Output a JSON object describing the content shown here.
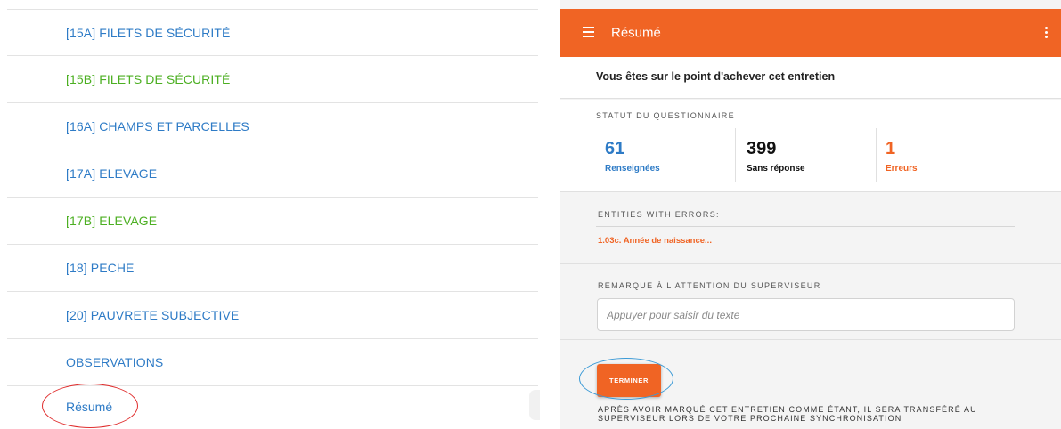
{
  "sections": {
    "items": [
      {
        "code": "[15A]",
        "name": "FILETS DE SÉCURITÉ",
        "color": "#2e7bc6"
      },
      {
        "code": "[15B]",
        "name": "FILETS DE SÉCURITÉ",
        "color": "#4caf22"
      },
      {
        "code": "[16A]",
        "name": "CHAMPS ET PARCELLES",
        "color": "#2e7bc6"
      },
      {
        "code": "[17A]",
        "name": "ELEVAGE",
        "color": "#2e7bc6"
      },
      {
        "code": "[17B]",
        "name": "ELEVAGE",
        "color": "#4caf22"
      },
      {
        "code": "[18]",
        "name": "PECHE",
        "color": "#2e7bc6"
      },
      {
        "code": "[20]",
        "name": "PAUVRETE SUBJECTIVE",
        "color": "#2e7bc6"
      },
      {
        "code": "",
        "name": "OBSERVATIONS",
        "color": "#2e7bc6"
      }
    ],
    "resume_label": "Résumé"
  },
  "appbar": {
    "title": "Résumé",
    "menu_icon": "hamburger-menu-icon",
    "more_icon": "more-vertical-icon",
    "color": "#f06424"
  },
  "intro": {
    "text": "Vous êtes sur le point d'achever cet entretien"
  },
  "status": {
    "title": "STATUT DU QUESTIONNAIRE",
    "filled": {
      "count": "61",
      "label": "Renseignées",
      "color": "#2e7bc6"
    },
    "unanswered": {
      "count": "399",
      "label": "Sans réponse",
      "color": "#111111"
    },
    "errors": {
      "count": "1",
      "label": "Erreurs",
      "color": "#f06424"
    }
  },
  "errors": {
    "title": "ENTITIES WITH ERRORS:",
    "items": [
      "1.03c. Année de naissance..."
    ]
  },
  "comment": {
    "title": "REMARQUE À L'ATTENTION DU SUPERVISEUR",
    "placeholder": "Appuyer pour saisir du texte",
    "value": ""
  },
  "finish": {
    "button_label": "TERMINER",
    "note": "APRÈS AVOIR MARQUÉ CET ENTRETIEN COMME ÉTANT, IL SERA TRANSFÉRÉ AU SUPERVISEUR LORS DE VOTRE PROCHAINE SYNCHRONISATION"
  }
}
